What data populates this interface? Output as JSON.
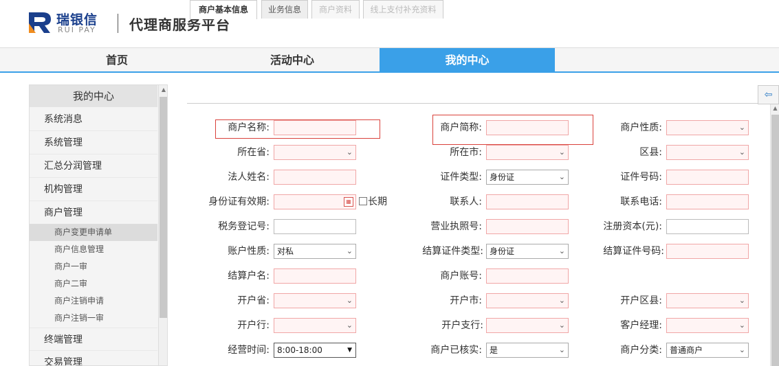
{
  "header": {
    "brand_cn": "瑞银信",
    "brand_en": "RUI PAY",
    "platform_title": "代理商服务平台"
  },
  "nav": {
    "items": [
      {
        "label": "首页"
      },
      {
        "label": "活动中心"
      },
      {
        "label": "我的中心"
      }
    ],
    "active": "我的中心"
  },
  "sidebar": {
    "title": "我的中心",
    "items": [
      {
        "label": "系统消息"
      },
      {
        "label": "系统管理"
      },
      {
        "label": "汇总分润管理"
      },
      {
        "label": "机构管理"
      },
      {
        "label": "商户管理"
      },
      {
        "label": "终端管理"
      },
      {
        "label": "交易管理"
      }
    ],
    "sub_items": [
      {
        "label": "商户变更申请单"
      },
      {
        "label": "商户信息管理"
      },
      {
        "label": "商户一审"
      },
      {
        "label": "商户二审"
      },
      {
        "label": "商户注销申请"
      },
      {
        "label": "商户注销一审"
      }
    ],
    "active_sub": "商户变更申请单"
  },
  "tabs": [
    {
      "label": "商户基本信息",
      "state": "active"
    },
    {
      "label": "业务信息",
      "state": "normal"
    },
    {
      "label": "商户资料",
      "state": "disabled"
    },
    {
      "label": "线上支付补充资料",
      "state": "disabled"
    }
  ],
  "form": {
    "labels": {
      "merchant_name": "商户名称:",
      "merchant_short": "商户简称:",
      "merchant_nature": "商户性质:",
      "province": "所在省:",
      "city": "所在市:",
      "county": "区县:",
      "legal_name": "法人姓名:",
      "cert_type": "证件类型:",
      "cert_no": "证件号码:",
      "id_valid": "身份证有效期:",
      "long_term": "长期",
      "contact": "联系人:",
      "contact_phone": "联系电话:",
      "tax_no": "税务登记号:",
      "license_no": "营业执照号:",
      "reg_capital": "注册资本(元):",
      "account_nature": "账户性质:",
      "settle_cert_type": "结算证件类型:",
      "settle_cert_no": "结算证件号码:",
      "settle_name": "结算户名:",
      "account_no": "商户账号:",
      "bank_province": "开户省:",
      "bank_city": "开户市:",
      "bank_county": "开户区县:",
      "bank": "开户行:",
      "bank_branch": "开户支行:",
      "manager": "客户经理:",
      "biz_hours": "经营时间:",
      "verified": "商户已核实:",
      "category": "商户分类:"
    },
    "values": {
      "cert_type": "身份证",
      "account_nature": "对私",
      "settle_cert_type": "身份证",
      "biz_hours": "8:00-18:00",
      "verified": "是",
      "category": "普通商户"
    }
  },
  "colors": {
    "accent": "#3aa0e8",
    "required_border": "#f0a6a6",
    "required_bg": "#fff4f4",
    "highlight": "#d9403a",
    "brand": "#1a3f8c"
  }
}
